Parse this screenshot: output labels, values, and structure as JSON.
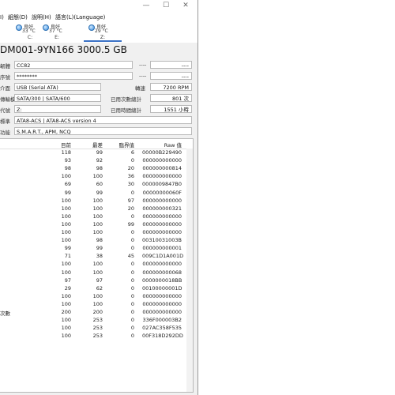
{
  "menu": {
    "items": [
      "Ⅰ)",
      "組態(D)",
      "說明(H)",
      "語言(L)(Language)"
    ]
  },
  "window_controls": {
    "minimize": "—",
    "maximize": "☐",
    "close": "✕"
  },
  "drives": [
    {
      "status": "良好",
      "temp": "33 °C",
      "letter": "C:"
    },
    {
      "status": "良好",
      "temp": "37 °C",
      "letter": "E:"
    },
    {
      "status": "良好",
      "temp": "29 °C",
      "letter": "Z:",
      "active": true
    }
  ],
  "disk_title": "DM001-9YN166 3000.5 GB",
  "info": {
    "firmware_label": "韌體",
    "firmware": "CC82",
    "serial_label": "序號",
    "serial": "********",
    "interface_label": "介面",
    "interface": "USB (Serial ATA)",
    "transfer_label": "傳輸模式",
    "transfer": "SATA/300 | SATA/600",
    "drive_letter_label": "代號",
    "drive_letter": "Z:",
    "standard_label": "標準",
    "standard": "ATA8-ACS | ATA8-ACS version 4",
    "features_label": "功能",
    "features": "S.M.A.R.T., APM, NCQ",
    "right_top_1": "----",
    "right_top_1_dash": "----",
    "right_top_2": "----",
    "right_top_2_dash": "----",
    "rpm_label": "轉速",
    "rpm": "7200 RPM",
    "power_count_label": "已用次數總計",
    "power_count": "801 次",
    "power_hours_label": "已用時間總計",
    "power_hours": "1551 小時"
  },
  "table": {
    "headers": {
      "current": "目前",
      "worst": "最差",
      "threshold": "臨界值",
      "raw": "Raw 值"
    },
    "rows": [
      {
        "name": "",
        "current": "118",
        "worst": "99",
        "threshold": "6",
        "raw": "00000B229490"
      },
      {
        "name": "",
        "current": "93",
        "worst": "92",
        "threshold": "0",
        "raw": "000000000000"
      },
      {
        "name": "",
        "current": "98",
        "worst": "98",
        "threshold": "20",
        "raw": "000000000814"
      },
      {
        "name": "",
        "current": "100",
        "worst": "100",
        "threshold": "36",
        "raw": "000000000000"
      },
      {
        "name": "",
        "current": "69",
        "worst": "60",
        "threshold": "30",
        "raw": "0000009847B0"
      },
      {
        "name": "",
        "current": "99",
        "worst": "99",
        "threshold": "0",
        "raw": "00000000060F"
      },
      {
        "name": "",
        "current": "100",
        "worst": "100",
        "threshold": "97",
        "raw": "000000000000"
      },
      {
        "name": "",
        "current": "100",
        "worst": "100",
        "threshold": "20",
        "raw": "000000000321"
      },
      {
        "name": "",
        "current": "100",
        "worst": "100",
        "threshold": "0",
        "raw": "000000000000"
      },
      {
        "name": "",
        "current": "100",
        "worst": "100",
        "threshold": "99",
        "raw": "000000000000"
      },
      {
        "name": "",
        "current": "100",
        "worst": "100",
        "threshold": "0",
        "raw": "000000000000"
      },
      {
        "name": "",
        "current": "100",
        "worst": "98",
        "threshold": "0",
        "raw": "00310031003B"
      },
      {
        "name": "",
        "current": "99",
        "worst": "99",
        "threshold": "0",
        "raw": "000000000001"
      },
      {
        "name": "",
        "current": "71",
        "worst": "38",
        "threshold": "45",
        "raw": "009C1D1A001D"
      },
      {
        "name": "",
        "current": "100",
        "worst": "100",
        "threshold": "0",
        "raw": "000000000000"
      },
      {
        "name": "",
        "current": "100",
        "worst": "100",
        "threshold": "0",
        "raw": "000000000068"
      },
      {
        "name": "",
        "current": "97",
        "worst": "97",
        "threshold": "0",
        "raw": "0000000018BB"
      },
      {
        "name": "",
        "current": "29",
        "worst": "62",
        "threshold": "0",
        "raw": "00100000001D"
      },
      {
        "name": "",
        "current": "100",
        "worst": "100",
        "threshold": "0",
        "raw": "000000000000"
      },
      {
        "name": "",
        "current": "100",
        "worst": "100",
        "threshold": "0",
        "raw": "000000000000"
      },
      {
        "name": "次數",
        "current": "200",
        "worst": "200",
        "threshold": "0",
        "raw": "000000000000"
      },
      {
        "name": "",
        "current": "100",
        "worst": "253",
        "threshold": "0",
        "raw": "336F000003B2"
      },
      {
        "name": "",
        "current": "100",
        "worst": "253",
        "threshold": "0",
        "raw": "027AC358F535"
      },
      {
        "name": "",
        "current": "100",
        "worst": "253",
        "threshold": "0",
        "raw": "00F318D292DD"
      }
    ]
  }
}
